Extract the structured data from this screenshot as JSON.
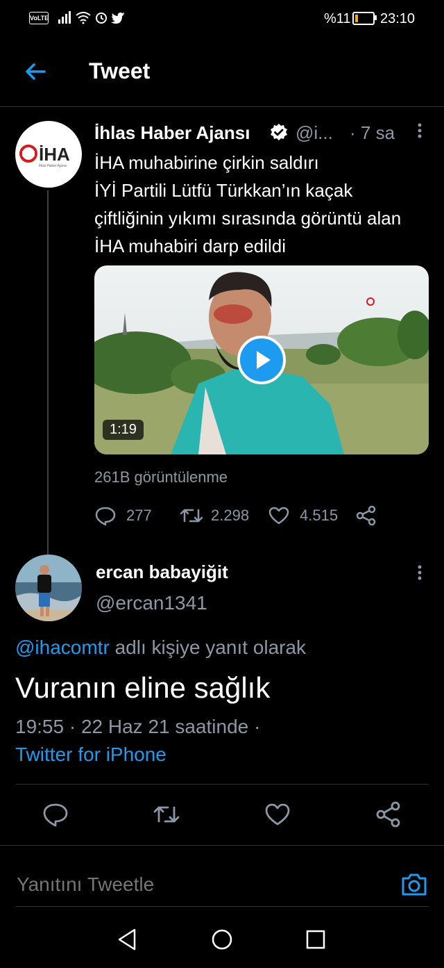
{
  "status_bar": {
    "volte": "VoLTE",
    "battery_pct": "%11",
    "time": "23:10"
  },
  "header": {
    "title": "Tweet"
  },
  "parent_tweet": {
    "author_name": "İhlas Haber Ajansı",
    "author_handle": "@i...",
    "time": "· 7 sa",
    "text": "İHA muhabirine çirkin saldırı\nİYİ Partili Lütfü Türkkan’ın kaçak çiftliğinin yıkımı sırasında görüntü alan İHA muhabiri darp edildi",
    "logo_text": "İHA",
    "logo_subtitle": "İhlas Haber Ajansı",
    "video_duration": "1:19",
    "views": "261B görüntülenme",
    "replies": "277",
    "retweets": "2.298",
    "likes": "4.515"
  },
  "reply": {
    "author_name": "ercan babayiğit",
    "author_handle": "@ercan1341",
    "mention": "@ihacomtr",
    "context_suffix": " adlı kişiye yanıt olarak",
    "text": "Vuranın eline sağlık",
    "meta": "19:55 · 22 Haz 21 saatinde ·",
    "source": "Twitter for iPhone"
  },
  "compose": {
    "placeholder": "Yanıtını Tweetle"
  },
  "colors": {
    "accent": "#1d9bf0",
    "muted": "#8b98a5",
    "background": "#000000"
  }
}
